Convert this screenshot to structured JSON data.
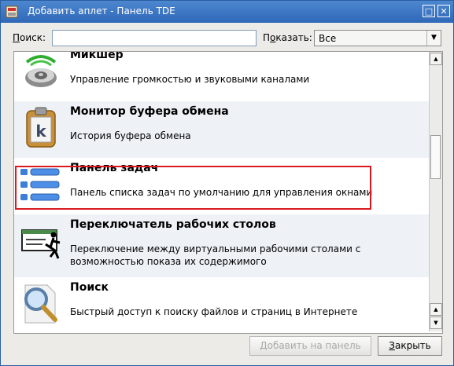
{
  "window": {
    "title": "Добавить аплет - Панель TDE",
    "buttons": [
      {
        "icon": "maximize-icon",
        "glyph": "□"
      },
      {
        "icon": "close-icon",
        "glyph": "✕"
      }
    ]
  },
  "search": {
    "label_first": "П",
    "label_rest": "оиск:",
    "value": "",
    "placeholder": ""
  },
  "filter": {
    "label_first": "П",
    "label_underlined": "о",
    "label_rest": "казать:",
    "selected": "Все"
  },
  "applets": [
    {
      "title": "Микшер",
      "description": "Управление громкостью и звуковыми каналами",
      "icon": "speaker-icon"
    },
    {
      "title": "Монитор буфера обмена",
      "description": "История буфера обмена",
      "icon": "clipboard-icon"
    },
    {
      "title": "Панель задач",
      "description": "Панель списка задач по умолчанию для управления окнами",
      "icon": "taskbar-icon"
    },
    {
      "title": "Переключатель рабочих столов",
      "description": "Переключение между виртуальными рабочими столами с возможностью показа их содержимого",
      "icon": "desktop-pager-icon"
    },
    {
      "title": "Поиск",
      "description": "Быстрый доступ к поиску файлов и страниц в Интернете",
      "icon": "search-magnifier-icon"
    }
  ],
  "footer": {
    "add_label": "Добавить на панель",
    "close_label": "Закрыть",
    "close_underlined": "З",
    "close_rest": "акрыть"
  }
}
